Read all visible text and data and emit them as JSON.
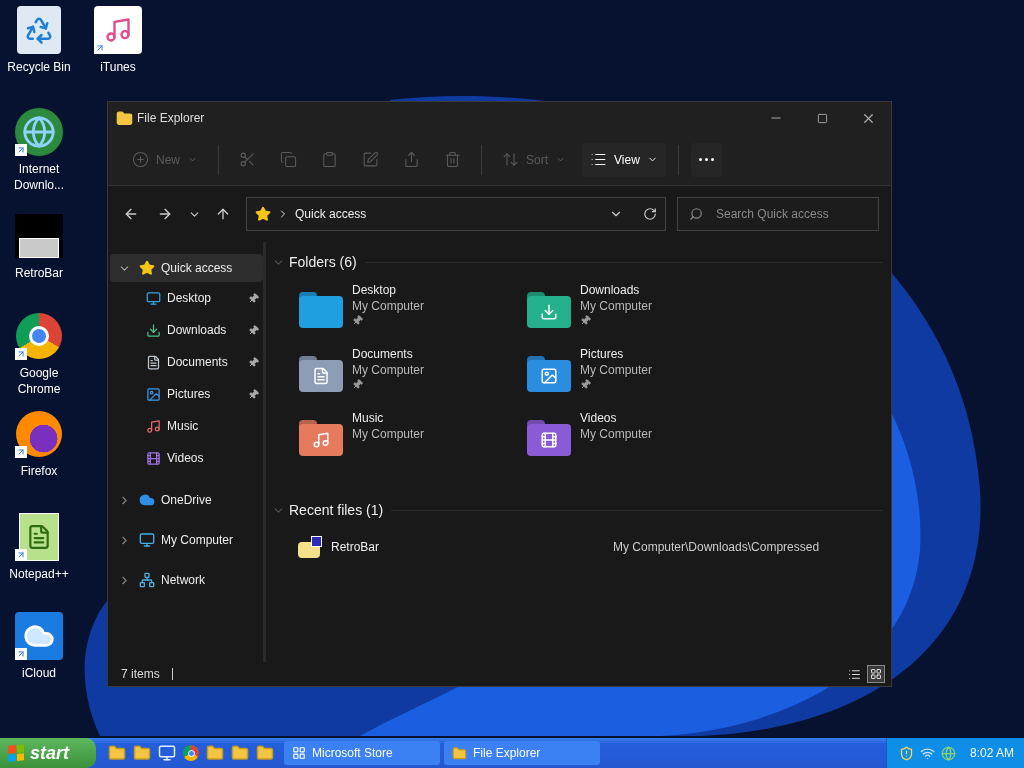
{
  "desktop_icons": [
    {
      "label": "Recycle Bin",
      "shortcut": false
    },
    {
      "label": "iTunes",
      "shortcut": true
    },
    {
      "label": "Internet Downlo...",
      "shortcut": true
    },
    {
      "label": "RetroBar",
      "shortcut": false
    },
    {
      "label": "Google Chrome",
      "shortcut": true
    },
    {
      "label": "Firefox",
      "shortcut": true
    },
    {
      "label": "Notepad++",
      "shortcut": true
    },
    {
      "label": "iCloud",
      "shortcut": true
    }
  ],
  "window": {
    "title": "File Explorer",
    "toolbar": [
      {
        "kind": "new",
        "label": "New",
        "disabled": true
      },
      {
        "kind": "cut",
        "disabled": true
      },
      {
        "kind": "copy",
        "disabled": true
      },
      {
        "kind": "paste",
        "disabled": true
      },
      {
        "kind": "rename",
        "disabled": true
      },
      {
        "kind": "share",
        "disabled": true
      },
      {
        "kind": "delete",
        "disabled": true
      },
      {
        "kind": "sort",
        "label": "Sort",
        "disabled": true
      },
      {
        "kind": "view",
        "label": "View",
        "disabled": false
      },
      {
        "kind": "more",
        "disabled": false
      }
    ],
    "address": {
      "path": "Quick access"
    },
    "search": {
      "placeholder": "Search Quick access"
    },
    "sidebar": [
      {
        "label": "Quick access",
        "expanded": true,
        "selected": true,
        "children": [
          {
            "label": "Desktop",
            "pinned": true,
            "selected": false
          },
          {
            "label": "Downloads",
            "pinned": true,
            "selected": false
          },
          {
            "label": "Documents",
            "pinned": true,
            "selected": false
          },
          {
            "label": "Pictures",
            "pinned": true,
            "selected": false
          },
          {
            "label": "Music",
            "pinned": false,
            "selected": false
          },
          {
            "label": "Videos",
            "pinned": false,
            "selected": false
          }
        ]
      },
      {
        "label": "OneDrive",
        "expanded": false,
        "selected": false
      },
      {
        "label": "My Computer",
        "expanded": false,
        "selected": false
      },
      {
        "label": "Network",
        "expanded": false,
        "selected": false
      }
    ],
    "folders": {
      "heading": "Folders (6)",
      "expanded": true,
      "items": [
        {
          "name": "Desktop",
          "location": "My Computer",
          "pinned": true
        },
        {
          "name": "Downloads",
          "location": "My Computer",
          "pinned": true
        },
        {
          "name": "Documents",
          "location": "My Computer",
          "pinned": true
        },
        {
          "name": "Pictures",
          "location": "My Computer",
          "pinned": true
        },
        {
          "name": "Music",
          "location": "My Computer",
          "pinned": false
        },
        {
          "name": "Videos",
          "location": "My Computer",
          "pinned": false
        }
      ]
    },
    "recent": {
      "heading": "Recent files (1)",
      "expanded": true,
      "items": [
        {
          "name": "RetroBar",
          "path": "My Computer\\Downloads\\Compressed"
        }
      ]
    },
    "status_bar": {
      "count": "7 items",
      "views": [
        {
          "kind": "details",
          "selected": false
        },
        {
          "kind": "tiles",
          "selected": true
        }
      ]
    }
  },
  "taskbar": {
    "start": "start",
    "tasks": [
      {
        "label": "Microsoft Store",
        "selected": false
      },
      {
        "label": "File Explorer",
        "selected": false
      }
    ],
    "clock": "8:02 AM"
  }
}
